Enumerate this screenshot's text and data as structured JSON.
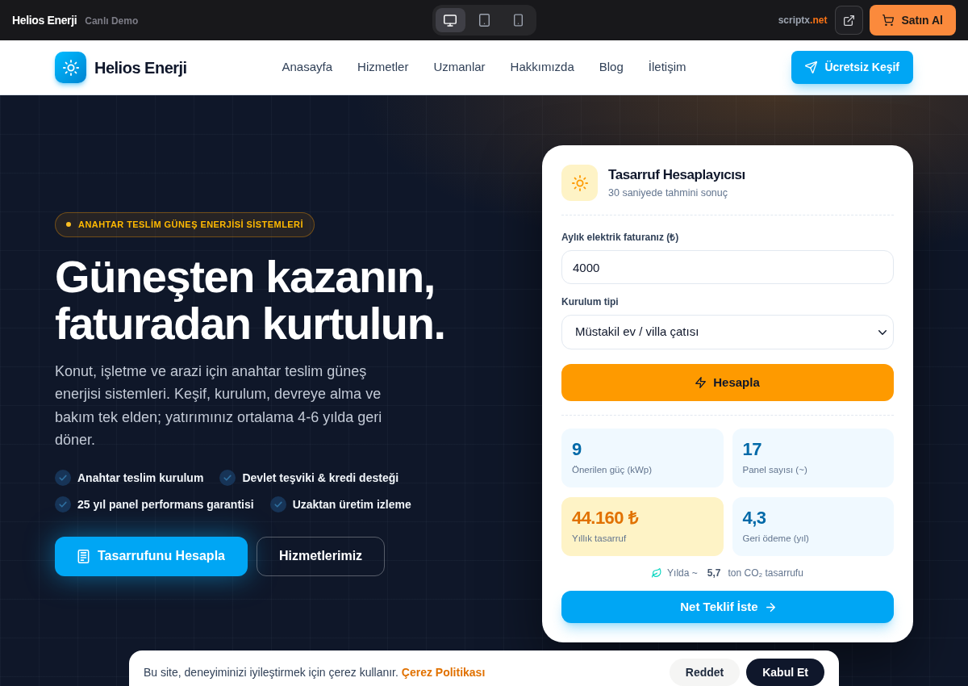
{
  "topbar": {
    "brand": "Helios Enerji",
    "tag": "Canlı Demo",
    "devices": [
      {
        "kind": "desktop",
        "selected": true
      },
      {
        "kind": "tablet",
        "selected": false
      },
      {
        "kind": "mobile",
        "selected": false
      }
    ],
    "site_name": "scriptx",
    "site_tld": ".net",
    "buy_button": "Satın Al"
  },
  "navbar": {
    "brand": "Helios Enerji",
    "links": [
      "Anasayfa",
      "Hizmetler",
      "Uzmanlar",
      "Hakkımızda",
      "Blog",
      "İletişim"
    ],
    "cta": "Ücretsiz Keşif"
  },
  "hero": {
    "badge": "ANAHTAR TESLİM GÜNEŞ ENERJİSİ SİSTEMLERİ",
    "heading": "Güneşten kazanın, faturadan kurtulun.",
    "description": "Konut, işletme ve arazi için anahtar teslim güneş enerjisi sistemleri. Keşif, kurulum, devreye alma ve bakım tek elden; yatırımınız ortalama 4-6 yılda geri döner.",
    "features": [
      "Anahtar teslim kurulum",
      "Devlet teşviki & kredi desteği",
      "25 yıl panel performans garantisi",
      "Uzaktan üretim izleme"
    ],
    "primary_button": "Tasarrufunu Hesapla",
    "secondary_button": "Hizmetlerimiz"
  },
  "calculator": {
    "title": "Tasarruf Hesaplayıcısı",
    "subtitle": "30 saniyede tahmini sonuç",
    "bill_label": "Aylık elektrik faturanız (₺)",
    "bill_value": "4000",
    "type_label": "Kurulum tipi",
    "type_value": "Müstakil ev / villa çatısı",
    "calculate_button": "Hesapla",
    "results": [
      {
        "value": "9",
        "label": "Önerilen güç (kWp)",
        "highlighted": false
      },
      {
        "value": "17",
        "label": "Panel sayısı (~)",
        "highlighted": false
      },
      {
        "value": "44.160 ₺",
        "label": "Yıllık tasarruf",
        "highlighted": true
      },
      {
        "value": "4,3",
        "label": "Geri ödeme (yıl)",
        "highlighted": false
      }
    ],
    "co2": {
      "prefix": "Yılda ~",
      "amount": "5,7",
      "suffix": "ton CO₂ tasarrufu"
    },
    "quote_button": "Net Teklif İste"
  },
  "cookie_banner": {
    "text": "Bu site, deneyiminizi iyileştirmek için çerez kullanır.",
    "link": "Çerez Politikası",
    "reject_button": "Reddet",
    "accept_button": "Kabul Et"
  }
}
